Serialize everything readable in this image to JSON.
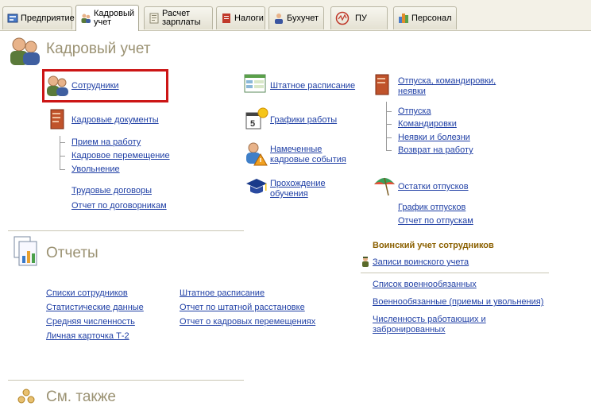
{
  "tabs": [
    {
      "label": "Предприятие"
    },
    {
      "label": "Кадровый учет"
    },
    {
      "label": "Расчет зарплаты"
    },
    {
      "label": "Налоги"
    },
    {
      "label": "Бухучет"
    },
    {
      "label": "ПУ"
    },
    {
      "label": "Персонал"
    }
  ],
  "kadr": {
    "title": "Кадровый учет",
    "employees": "Сотрудники",
    "kadr_docs": "Кадровые документы",
    "hire": "Прием на  работу",
    "transfer": "Кадровое перемещение",
    "dismissal": "Увольнение",
    "labor_contracts": "Трудовые договоры",
    "contractors_report": "Отчет по договорникам",
    "staff_schedule": "Штатное расписание",
    "work_schedules": "Графики  работы",
    "planned_events": "Намеченные кадровые события",
    "training": "Прохождение обучения",
    "vacations_header": "Отпуска, командировки, неявки",
    "vacation": "Отпуска",
    "business_trips": "Командировки",
    "absences": "Неявки и болезни",
    "return_work": "Возврат на работу",
    "vacation_balance": "Остатки отпусков",
    "vacation_schedule": "График отпусков",
    "vacation_report": "Отчет по отпускам"
  },
  "reports": {
    "title": "Отчеты",
    "employee_lists": "Списки сотрудников",
    "statistics": "Статистические данные",
    "avg_headcount": "Средняя численность",
    "personal_card": "Личная карточка Т-2",
    "staff_schedule": "Штатное расписание",
    "staff_placement": "Отчет по штатной расстановке",
    "kadr_moves": "Отчет о кадровых перемещениях"
  },
  "military": {
    "title": "Воинский учет сотрудников",
    "records": "Записи воинского учета",
    "list": "Список военнообязанных",
    "hires_dismissals": "Военнообязанные (приемы и увольнения)",
    "reserved": "Численность работающих и забронированных"
  },
  "see_also": {
    "title": "См. также"
  }
}
